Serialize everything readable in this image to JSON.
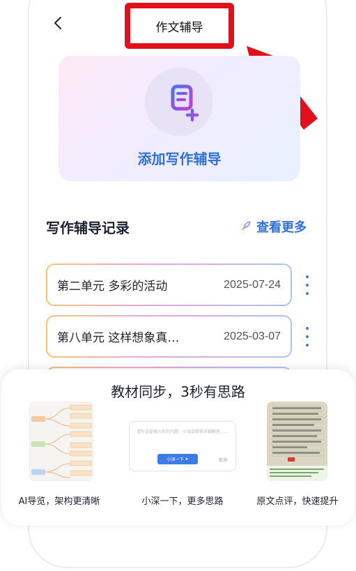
{
  "header": {
    "title": "作文辅导"
  },
  "add_card": {
    "label": "添加写作辅导"
  },
  "records": {
    "section_title": "写作辅导记录",
    "more_label": "查看更多",
    "items": [
      {
        "title": "第二单元 多彩的活动",
        "date": "2025-07-24"
      },
      {
        "title": "第八单元 这样想象真…",
        "date": "2025-03-07"
      }
    ]
  },
  "sheet": {
    "title": "教材同步，3秒有思路",
    "features": [
      {
        "caption": "AI导览，架构更清晰"
      },
      {
        "caption": "小深一下，更多思路"
      },
      {
        "caption": "原文点评，快速提升"
      }
    ],
    "input_demo": {
      "placeholder": "请在这处输入你的问题，小深会帮你详细解答……",
      "button": "小深一下",
      "cancel": "取消"
    }
  },
  "colors": {
    "accent": "#2f6fd8",
    "highlight_red": "#e1101a"
  }
}
